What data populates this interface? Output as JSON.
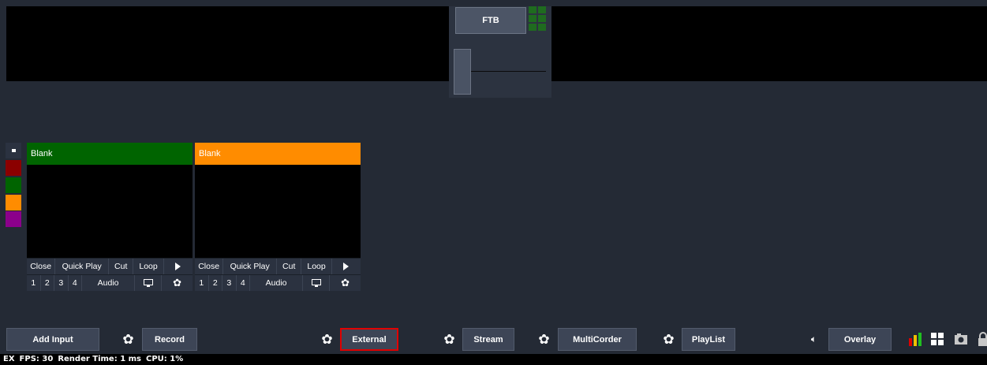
{
  "ftb": {
    "label": "FTB"
  },
  "color_palette": {
    "toggle_icon": "minimize-icon",
    "colors": [
      "#8b0000",
      "#006400",
      "#ff8c00",
      "#8b008b"
    ]
  },
  "inputs": [
    {
      "title": "Blank",
      "title_color": "#006400",
      "controls": [
        "Close",
        "Quick Play",
        "Cut",
        "Loop"
      ],
      "overlays": [
        "1",
        "2",
        "3",
        "4"
      ],
      "audio_label": "Audio"
    },
    {
      "title": "Blank",
      "title_color": "#ff8c00",
      "controls": [
        "Close",
        "Quick Play",
        "Cut",
        "Loop"
      ],
      "overlays": [
        "1",
        "2",
        "3",
        "4"
      ],
      "audio_label": "Audio"
    }
  ],
  "toolbar": {
    "add_input": "Add Input",
    "record": "Record",
    "external": "External",
    "stream": "Stream",
    "multicorder": "MultiCorder",
    "playlist": "PlayList",
    "overlay": "Overlay",
    "highlight_color": "#e00000"
  },
  "status_bar": {
    "ex": "EX",
    "fps": "FPS:  30",
    "render_time": "Render Time:  1 ms",
    "cpu": "CPU:  1%"
  }
}
